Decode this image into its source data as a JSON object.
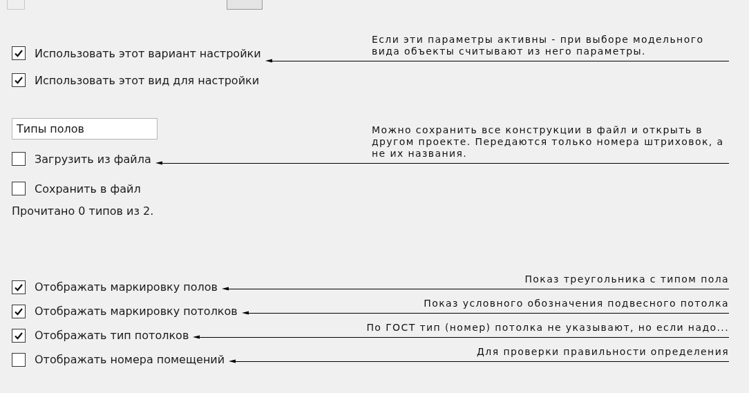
{
  "model_view": {
    "options": [
      {
        "label": "Использовать этот вариант настройки",
        "checked": true
      },
      {
        "label": "Использовать этот вид для настройки",
        "checked": true
      }
    ],
    "note": "Если эти параметры активны - при выборе модельного вида объекты считывают из него параметры."
  },
  "floor_types": {
    "name_field": {
      "value": "Типы полов"
    },
    "load": {
      "label": "Загрузить из файла",
      "checked": false,
      "note": "Можно сохранить все конструкции в файл и открыть в другом проекте. Передаются только номера штриховок, а не их названия."
    },
    "save": {
      "label": "Сохранить в файл",
      "checked": false
    },
    "status": "Прочитано 0 типов из 2."
  },
  "display_options": [
    {
      "label": "Отображать маркировку полов",
      "checked": true,
      "note": "Показ треугольника с типом пола"
    },
    {
      "label": "Отображать маркировку потолков",
      "checked": true,
      "note": "Показ условного обозначения подвесного потолка"
    },
    {
      "label": "Отображать тип потолков",
      "checked": true,
      "note": "По ГОСТ тип (номер) потолка не указывают, но если надо..."
    },
    {
      "label": "Отображать номера помещений",
      "checked": false,
      "note": "Для проверки правильности определения"
    }
  ]
}
